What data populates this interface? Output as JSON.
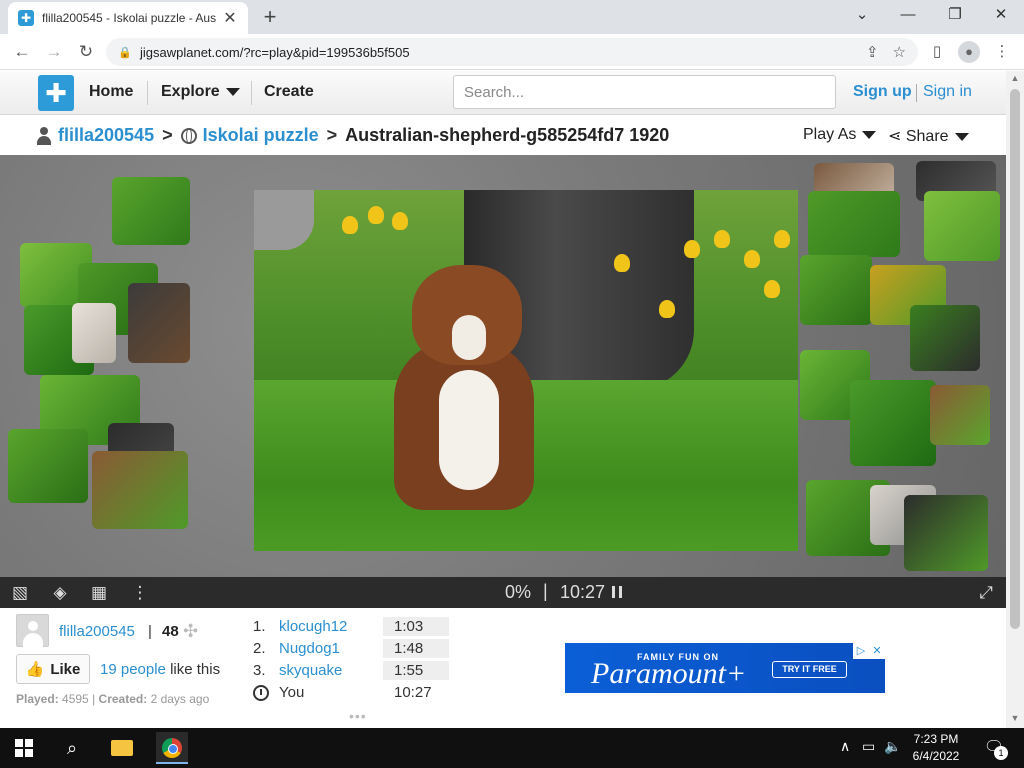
{
  "browser": {
    "tab_title": "flilla200545 - Iskolai puzzle - Aus",
    "url": "jigsawplanet.com/?rc=play&pid=199536b5f505"
  },
  "site": {
    "nav": {
      "home": "Home",
      "explore": "Explore",
      "create": "Create"
    },
    "search_placeholder": "Search...",
    "signup": "Sign up",
    "signin": "Sign in"
  },
  "breadcrumb": {
    "user": "flilla200545",
    "folder": "Iskolai puzzle",
    "puzzle": "Australian-shepherd-g585254fd7 1920",
    "separator": ">",
    "play_as": "Play As",
    "share": "Share"
  },
  "controls": {
    "progress": "0%",
    "separator": "|",
    "timer": "10:27"
  },
  "info": {
    "username": "flilla200545",
    "pipe": "|",
    "pieces": "48",
    "like_label": "Like",
    "likes_link": "19 people",
    "likes_suffix": " like this",
    "played_label": "Played:",
    "played_value": "4595",
    "created_label": "Created:",
    "created_value": "2 days ago",
    "scores": [
      {
        "rank": "1.",
        "name": "klocugh12",
        "time": "1:03"
      },
      {
        "rank": "2.",
        "name": "Nugdog1",
        "time": "1:48"
      },
      {
        "rank": "3.",
        "name": "skyquake",
        "time": "1:55"
      }
    ],
    "you_label": "You",
    "you_time": "10:27",
    "more": "•••"
  },
  "ad": {
    "small_text": "FAMILY FUN ON",
    "brand": "Paramount+",
    "cta": "TRY IT FREE"
  },
  "taskbar": {
    "time": "7:23 PM",
    "date": "6/4/2022",
    "notifications": "1"
  },
  "colors": {
    "link": "#2b8fd0",
    "logo": "#2d9bd7",
    "control_bar": "#2b2b2b",
    "ad_bg": "#0b5fd6"
  }
}
